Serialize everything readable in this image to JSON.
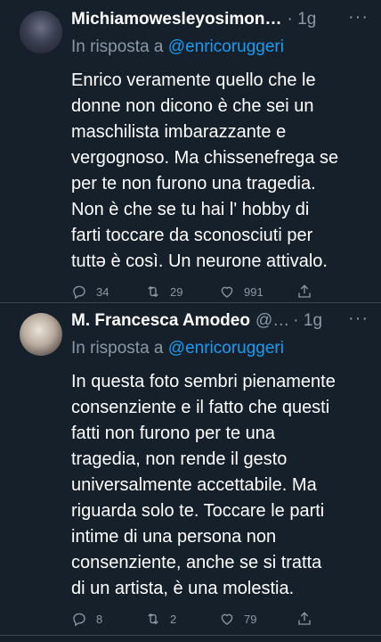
{
  "tweets": [
    {
      "author": "Michiamowesleyosimon…",
      "time": "· 1g",
      "more": "···",
      "reply_prefix": "In risposta a",
      "reply_handle": "@enricoruggeri",
      "text_lines": [
        "Enrico veramente quello che le",
        "donne non dicono è che sei un",
        "maschilista imbarazzante e",
        "vergognoso. Ma chissenefrega se",
        "per te non furono una tragedia.",
        "Non è che se tu hai l' hobby di",
        "farti toccare da sconosciuti per",
        "tuttə è così. Un neurone attivalo."
      ],
      "replies": "34",
      "retweets": "29",
      "likes": "991"
    },
    {
      "author": "M. Francesca Amodeo",
      "handle": "@…",
      "time": "· 1g",
      "more": "···",
      "reply_prefix": "In risposta a",
      "reply_handle": "@enricoruggeri",
      "text_lines": [
        "In questa foto sembri pienamente",
        "consenziente e il fatto che questi",
        "fatti non furono per te una",
        "tragedia, non rende il gesto",
        "universalmente accettabile. Ma",
        "riguarda solo te. Toccare le parti",
        "intime di una persona non",
        "consenziente, anche se si tratta",
        "di un artista, è una molestia."
      ],
      "replies": "8",
      "retweets": "2",
      "likes": "79"
    }
  ]
}
